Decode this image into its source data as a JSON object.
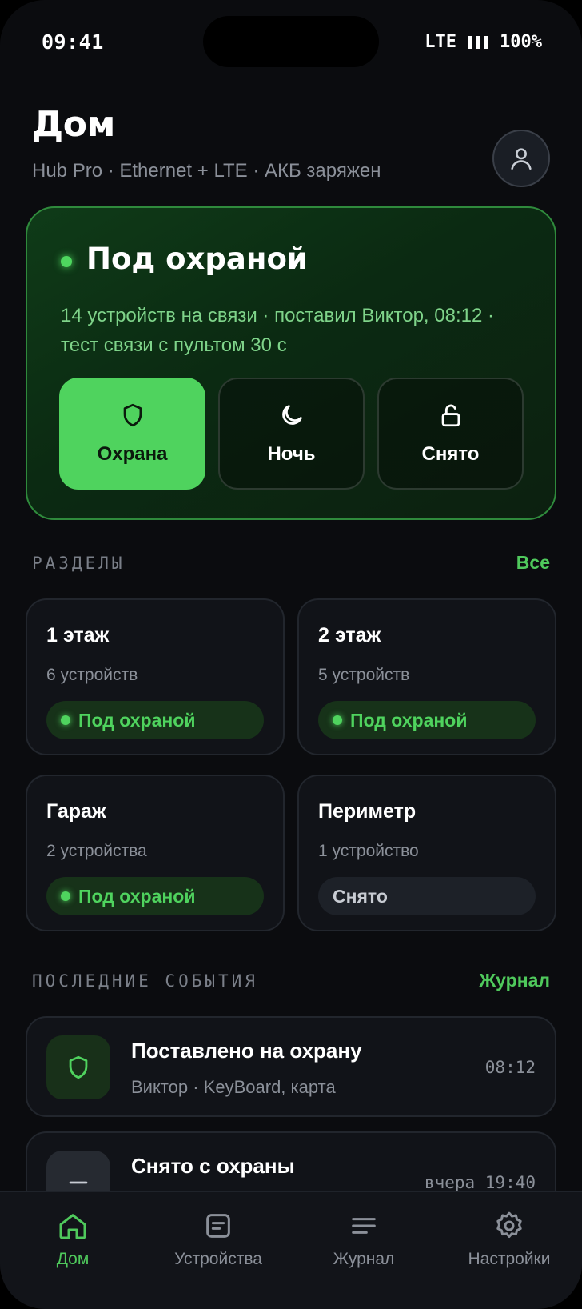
{
  "status_bar": {
    "time": "09:41",
    "network": "LTE",
    "battery": "100%"
  },
  "header": {
    "title": "Дом",
    "subtitle": "Hub Pro · Ethernet + LTE · АКБ заряжен"
  },
  "hero": {
    "state": "Под охраной",
    "description": "14 устройств на связи · поставил Виктор, 08:12 · тест связи с пультом 30 с",
    "modes": [
      {
        "label": "Охрана",
        "icon": "shield-icon",
        "active": true
      },
      {
        "label": "Ночь",
        "icon": "moon-icon",
        "active": false
      },
      {
        "label": "Снято",
        "icon": "unlock-icon",
        "active": false
      }
    ]
  },
  "zones_section": {
    "title": "РАЗДЕЛЫ",
    "link": "Все"
  },
  "zones": [
    {
      "name": "1 этаж",
      "count": "6 устройств",
      "status": "Под охраной",
      "armed": true
    },
    {
      "name": "2 этаж",
      "count": "5 устройств",
      "status": "Под охраной",
      "armed": true
    },
    {
      "name": "Гараж",
      "count": "2 устройства",
      "status": "Под охраной",
      "armed": true
    },
    {
      "name": "Периметр",
      "count": "1 устройство",
      "status": "Снято",
      "armed": false
    }
  ],
  "events_section": {
    "title": "ПОСЛЕДНИЕ СОБЫТИЯ",
    "link": "Журнал"
  },
  "events": [
    {
      "title": "Поставлено на охрану",
      "subtitle": "Виктор · KeyBoard, карта",
      "time": "08:12",
      "icon": "shield-icon"
    },
    {
      "title": "Снято с охраны",
      "subtitle": "",
      "time": "вчера 19:40",
      "icon": "minus-icon"
    }
  ],
  "tabbar": [
    {
      "label": "Дом",
      "icon": "home-icon",
      "active": true
    },
    {
      "label": "Устройства",
      "icon": "devices-icon",
      "active": false
    },
    {
      "label": "Журнал",
      "icon": "list-icon",
      "active": false
    },
    {
      "label": "Настройки",
      "icon": "gear-icon",
      "active": false
    }
  ],
  "colors": {
    "accent": "#4fd35e",
    "background": "#0b0c0f",
    "card": "#111318"
  }
}
